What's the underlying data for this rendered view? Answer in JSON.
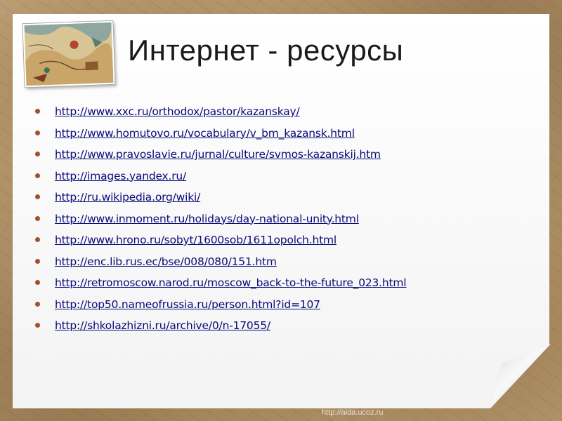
{
  "slide": {
    "title": "Интернет - ресурсы",
    "links": [
      "http://www.xxc.ru/orthodox/pastor/kazanskay/",
      "http://www.homutovo.ru/vocabulary/v_bm_kazansk.html",
      "http://www.pravoslavie.ru/jurnal/culture/svmos-kazanskij.htm",
      "http://images.yandex.ru/",
      "http://ru.wikipedia.org/wiki/",
      "http://www.inmoment.ru/holidays/day-national-unity.html",
      "http://www.hrono.ru/sobyt/1600sob/1611opolch.html",
      "http://enc.lib.rus.ec/bse/008/080/151.htm",
      "http://retromoscow.narod.ru/moscow_back-to-the-future_023.html",
      "http://top50.nameofrussia.ru/person.html?id=107",
      "http://shkolazhizni.ru/archive/0/n-17055/"
    ]
  },
  "watermark": "http://aida.ucoz.ru",
  "colors": {
    "link": "#0a0a7a",
    "bullet": "#a0522d",
    "title": "#1a1a1a",
    "paper": "#f7f7f7",
    "frame": "#b79a72"
  }
}
